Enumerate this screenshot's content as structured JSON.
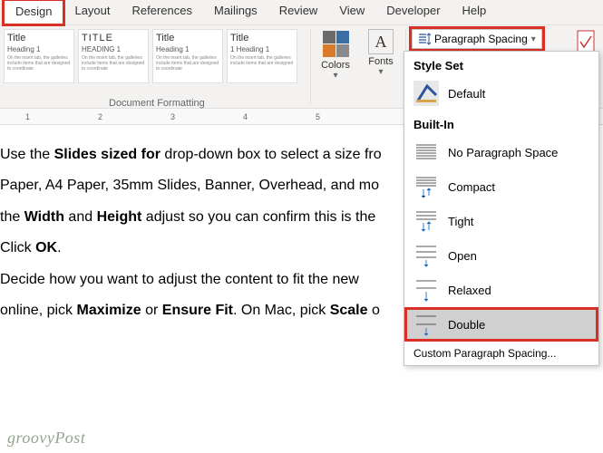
{
  "tabs": {
    "design": "Design",
    "layout": "Layout",
    "references": "References",
    "mailings": "Mailings",
    "review": "Review",
    "view": "View",
    "developer": "Developer",
    "help": "Help"
  },
  "ribbon": {
    "styles": [
      {
        "title": "Title",
        "heading": "Heading 1"
      },
      {
        "title": "TITLE",
        "heading": "HEADING 1"
      },
      {
        "title": "Title",
        "heading": "Heading 1"
      },
      {
        "title": "Title",
        "heading": "1 Heading 1"
      }
    ],
    "group_label": "Document Formatting",
    "colors": "Colors",
    "fonts": "Fonts",
    "para_spacing": "Paragraph Spacing"
  },
  "dropdown": {
    "style_set": "Style Set",
    "default": "Default",
    "built_in": "Built-In",
    "no_space": "No Paragraph Space",
    "compact": "Compact",
    "tight": "Tight",
    "open": "Open",
    "relaxed": "Relaxed",
    "double": "Double",
    "custom": "Custom Paragraph Spacing..."
  },
  "ruler": {
    "m1": "1",
    "m2": "2",
    "m3": "3",
    "m4": "4",
    "m5": "5"
  },
  "doc": {
    "p1a": "Use the ",
    "p1b": "Slides sized for",
    "p1c": " drop-down box to select a size fro",
    "p2": "Paper, A4 Paper, 35mm Slides, Banner, Overhead, and mo",
    "p3a": "the ",
    "p3b": "Width",
    "p3c": " and ",
    "p3d": "Height",
    "p3e": " adjust so you can confirm this is the",
    "p4a": "Click ",
    "p4b": "OK",
    "p4c": ".",
    "p5": "Decide how you want to adjust the content to fit the new",
    "p6a": "online, pick ",
    "p6b": "Maximize",
    "p6c": " or ",
    "p6d": "Ensure Fit",
    "p6e": ". On Mac, pick ",
    "p6f": "Scale",
    "p6g": " o"
  },
  "watermark": "groovyPost"
}
